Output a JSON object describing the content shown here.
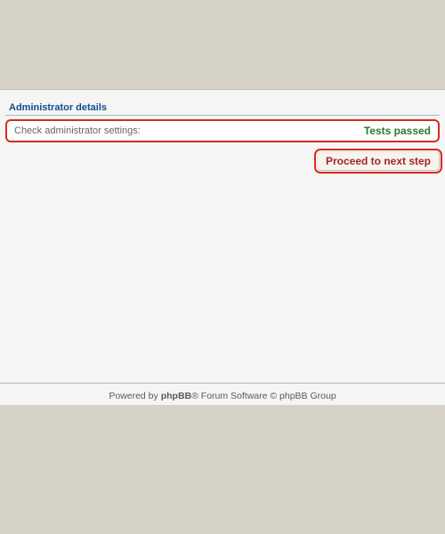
{
  "section": {
    "title": "Administrator details"
  },
  "result": {
    "label": "Check administrator settings:",
    "status": "Tests passed"
  },
  "action": {
    "proceed_label": "Proceed to next step"
  },
  "footer": {
    "prefix": "Powered by ",
    "brand": "phpBB",
    "suffix": "® Forum Software © phpBB Group"
  }
}
